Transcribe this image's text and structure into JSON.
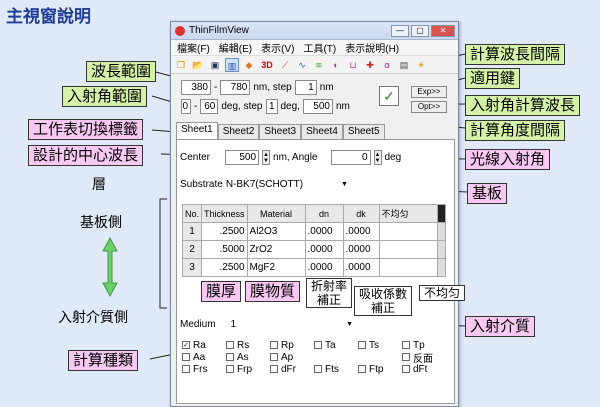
{
  "page_title": "主視窗說明",
  "window": {
    "title": "ThinFilmView",
    "buttons": [
      "—",
      "▢",
      "✕"
    ],
    "menu": [
      "檔案(F)",
      "編輯(E)",
      "表示(V)",
      "工具(T)",
      "表示說明(H)"
    ],
    "toolbar_icons": [
      "new-icon",
      "open-icon",
      "save-icon",
      "chart-icon",
      "color-icon",
      "3D",
      "line-icon",
      "wave-icon",
      "layer-icon",
      "pink-icon",
      "target-icon",
      "abc-icon",
      "db-icon",
      "sun-icon"
    ]
  },
  "wavelength": {
    "from": "380",
    "to": "780",
    "unit": "nm, step",
    "step": "1",
    "step_unit": "nm"
  },
  "angle": {
    "from": "0",
    "to": "60",
    "unit": "deg, step",
    "step": "1",
    "step_unit": "deg,",
    "wave": "500",
    "wave_unit": "nm"
  },
  "apply_symbol": "✓",
  "small_buttons": [
    "Exp>>",
    "Opt>>"
  ],
  "tabs": [
    "Sheet1",
    "Sheet2",
    "Sheet3",
    "Sheet4",
    "Sheet5"
  ],
  "center": {
    "label": "Center",
    "value": "500",
    "unit": "nm, Angle",
    "angle": "0",
    "angle_unit": "deg"
  },
  "substrate": {
    "label": "Substrate",
    "value": "N-BK7(SCHOTT)"
  },
  "table": {
    "headers": [
      "No.",
      "Thickness",
      "Material",
      "dn",
      "dk",
      "不均匀"
    ],
    "rows": [
      {
        "no": "1",
        "thickness": ".2500",
        "material": "Al2O3",
        "dn": ".0000",
        "dk": ".0000"
      },
      {
        "no": "2",
        "thickness": ".5000",
        "material": "ZrO2",
        "dn": ".0000",
        "dk": ".0000"
      },
      {
        "no": "3",
        "thickness": ".2500",
        "material": "MgF2",
        "dn": ".0000",
        "dk": ".0000"
      }
    ]
  },
  "medium": {
    "label": "Medium",
    "value": "1"
  },
  "checks": [
    [
      {
        "l": "Ra",
        "c": true
      },
      {
        "l": "Rs",
        "c": false
      },
      {
        "l": "Rp",
        "c": false
      },
      {
        "l": "Ta",
        "c": false
      },
      {
        "l": "Ts",
        "c": false
      },
      {
        "l": "Tp",
        "c": false
      }
    ],
    [
      {
        "l": "Aa",
        "c": false
      },
      {
        "l": "As",
        "c": false
      },
      {
        "l": "Ap",
        "c": false
      },
      {
        "l": "",
        "c": null
      },
      {
        "l": "",
        "c": null
      },
      {
        "l": "反面",
        "c": false
      }
    ],
    [
      {
        "l": "Frs",
        "c": false
      },
      {
        "l": "Frp",
        "c": false
      },
      {
        "l": "dFr",
        "c": false
      },
      {
        "l": "Fts",
        "c": false
      },
      {
        "l": "Ftp",
        "c": false
      },
      {
        "l": "dFt",
        "c": false
      }
    ]
  ],
  "callouts": {
    "wl_range": "波長範圍",
    "angle_range": "入射角範圍",
    "sheet_switch": "工作表切換標籤",
    "center_wl": "設計的中心波長",
    "calc_wl_interval": "計算波長間隔",
    "apply_key": "適用鍵",
    "angle_calc_wl": "入射角計算波長",
    "calc_angle_interval": "計算角度間隔",
    "light_angle": "光線入射角",
    "substrate": "基板",
    "thickness": "膜厚",
    "material": "膜物質",
    "dn": "折射率\n補正",
    "dk": "吸收係數\n補正",
    "nonuniform": "不均匀",
    "medium": "入射介質",
    "calc_type": "計算種類",
    "layer": "層",
    "substrate_side": "基板側",
    "medium_side": "入射介質側"
  },
  "colors": {
    "green_callout": "#d5f3a8",
    "pink_callout": "#f9c8f3",
    "title": "#1f3d99",
    "arrow": "#6ccf6c"
  }
}
